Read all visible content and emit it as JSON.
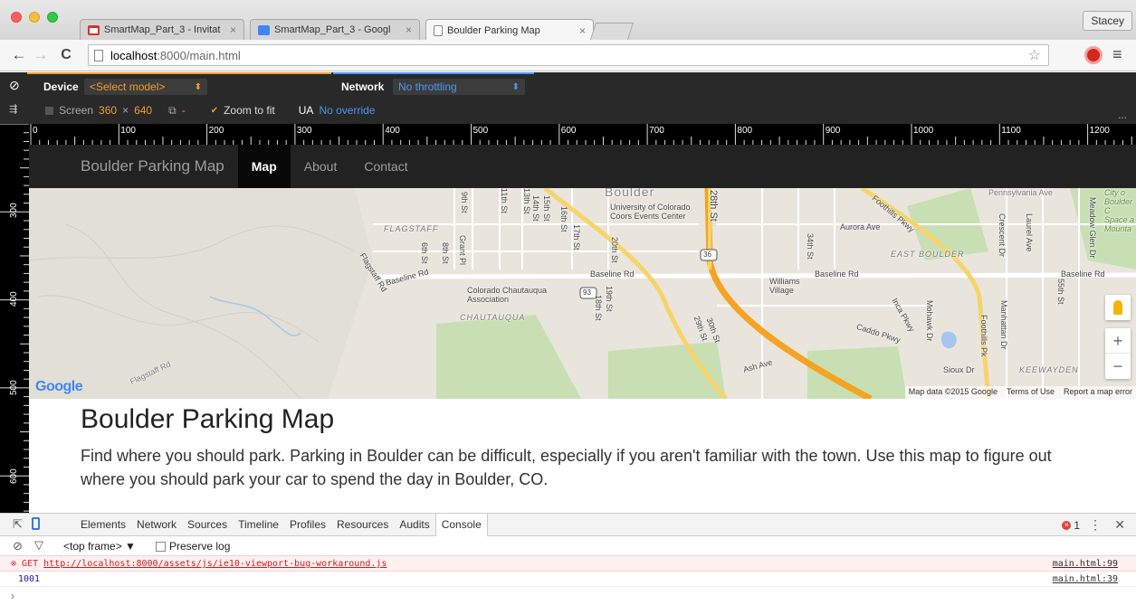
{
  "window": {
    "profile_name": "Stacey"
  },
  "tabs": [
    {
      "title": "SmartMap_Part_3 - Invitat",
      "favicon_color": "#d93025"
    },
    {
      "title": "SmartMap_Part_3 - Googl",
      "favicon_color": "#4285f4"
    },
    {
      "title": "Boulder Parking Map",
      "favicon_color": "#ffffff"
    }
  ],
  "toolbar": {
    "back_icon": "←",
    "forward_icon": "→",
    "reload_icon": "C",
    "url_host": "localhost",
    "url_path": ":8000/main.html",
    "star_icon": "☆",
    "menu_icon": "≡"
  },
  "emulation": {
    "ban_icon": "⊘",
    "device_label": "Device",
    "device_select": "<Select model>",
    "device_arrow": "⬍",
    "network_label": "Network",
    "network_select": "No throttling",
    "network_arrow": "⬍",
    "screen_label": "Screen",
    "screen_width": "360",
    "screen_x": "×",
    "screen_height": "640",
    "swap_icon": "⧉",
    "dash": "-",
    "zoom_to_fit": "Zoom to fit",
    "ua_label": "UA",
    "ua_value": "No override",
    "more": "..."
  },
  "ruler": {
    "h_labels": [
      "0",
      "100",
      "200",
      "300",
      "400",
      "500",
      "600",
      "700",
      "800",
      "900",
      "1000",
      "1100",
      "1200"
    ],
    "v_labels": [
      "300",
      "400",
      "500",
      "600"
    ]
  },
  "page": {
    "brand": "Boulder Parking Map",
    "nav": [
      "Map",
      "About",
      "Contact"
    ],
    "heading": "Boulder Parking Map",
    "paragraph": "Find where you should park. Parking in Boulder can be difficult, especially if you aren't familiar with the town. Use this map to figure out where you should park your car to spend the day in Boulder, CO."
  },
  "map": {
    "labels": {
      "boulder": "Boulder",
      "pennsylvania": "Pennsylvania Ave",
      "city_of_boulder": "City o Boulder C Space a Mounta",
      "cu": "University of Colorado Coors Events Center",
      "flagstaff": "FLAGSTAFF",
      "flagstaff_rd": "Flagstaff Rd",
      "flagstaff_rd2": "Flagstaff Rd",
      "baseline_rd1": "Baseline Rd",
      "baseline_rd2": "Baseline Rd",
      "baseline_rd3": "Baseline Rd",
      "baseline_rd4": "Baseline Rd",
      "chautauqua_assoc": "Colorado Chautauqua Association",
      "chautauqua": "CHAUTAUQUA",
      "aurora": "Aurora Ave",
      "east_boulder": "EAST BOULDER",
      "williams": "Williams Village",
      "caddo": "Caddo Pkwy",
      "ash": "Ash Ave",
      "sioux": "Sioux Dr",
      "keewayden": "KEEWAYDEN",
      "foothills": "Foothills Pkwy",
      "foothills2": "Foothills Pk",
      "hwy36": "36",
      "hwy93": "93",
      "st9": "9th St",
      "st11": "11th St",
      "st13": "13th St",
      "st14": "14th St",
      "st15": "15th St",
      "st16": "16th St",
      "st17": "17th St",
      "st20": "20th St",
      "st28": "28th St",
      "st34": "34th St",
      "st6": "6th St",
      "st8": "8th St",
      "grant": "Grant Pl",
      "st19": "19th St",
      "st18": "18th St",
      "st29": "29th St",
      "st30": "30th St",
      "crescent": "Crescent Dr",
      "laurel": "Laurel Ave",
      "meadow": "Meadow Glen Dr",
      "inca": "Inca Pkwy",
      "mohawk": "Mohawk Dr",
      "manhattan": "Manhattan Dr",
      "st55": "55th St"
    },
    "google": "Google",
    "footer": {
      "data": "Map data ©2015 Google",
      "terms": "Terms of Use",
      "report": "Report a map error"
    },
    "zoom_in": "+",
    "zoom_out": "−"
  },
  "devtools": {
    "tabs": [
      "Elements",
      "Network",
      "Sources",
      "Timeline",
      "Profiles",
      "Resources",
      "Audits",
      "Console"
    ],
    "active_tab": "Console",
    "error_count": "1",
    "frame": "<top frame> ▼",
    "preserve_log": "Preserve log",
    "logs": [
      {
        "method": "GET",
        "url": "http://localhost:8000/assets/js/ie10-viewport-bug-workaround.js",
        "source": "main.html:99"
      },
      {
        "message": "1001",
        "source": "main.html:39"
      }
    ],
    "prompt": "›"
  },
  "colors": {
    "navbar_bg": "#222222",
    "map_land": "#e9e5dc",
    "highway": "#f4a323",
    "devtools_blue": "#3879d9",
    "error_red": "#d92a2a"
  }
}
